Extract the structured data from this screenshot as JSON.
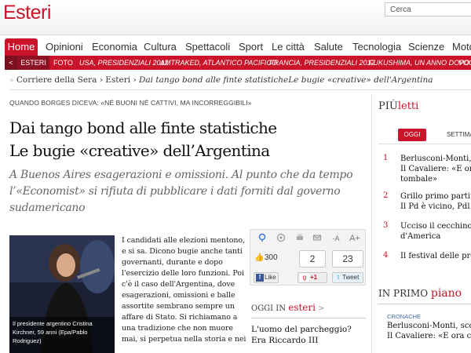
{
  "header": {
    "section_title": "Esteri",
    "search_placeholder": "Cerca"
  },
  "nav": {
    "items": [
      "Home",
      "Opinioni",
      "Economia",
      "Cultura",
      "Spettacoli",
      "Sport",
      "Le città",
      "Salute",
      "Tecnologia",
      "Scienze",
      "Moto"
    ]
  },
  "subnav": {
    "arrow": "<",
    "items": [
      "ESTERI",
      "FOTO",
      "USA, PRESIDENZIALI 2012",
      "AMTRAKED, ATLANTICO PACIFICO",
      "FRANCIA, PRESIDENZIALI 2012",
      "FUKUSHIMA, UN ANNO DOPO",
      "VOC"
    ]
  },
  "breadcrumb": {
    "items": [
      "Corriere della Sera",
      "Esteri",
      "Dai tango bond alle finte statisticheLe bugie «creative» dell'Argentina"
    ]
  },
  "article": {
    "kicker": "QUANDO BORGES DICEVA: «NÉ BUONI NÉ CATTIVI, MA INCORREGGIBILI»",
    "headline_line1": "Dai tango bond alle finte statistiche",
    "headline_line2": "Le bugie «creative» dell’Argentina",
    "subtitle": "A Buenos Aires esagerazioni e omissioni. Al punto che da tempo l’«Economist» si rifiuta di pubblicare i dati forniti dal governo sudamericano",
    "photo_caption": "Il presidente argentino Cristina Kirchner, 59 anni (Epa/Pablo Rodriguez)",
    "body_lines": [
      "I candidati alle elezioni mentono,",
      "e si sa. Dicono bugie anche tanti",
      "governanti, durante e dopo",
      "l'esercizio delle loro funzioni. Poi",
      "c'è il caso dell'Argentina, dove",
      "esagerazioni, omissioni e balle",
      "assortite sembrano sempre un",
      "affare di Stato. Si richiamano a",
      "una tradizione che non muore",
      "mai, si perpetua nella storia e nei"
    ]
  },
  "tools": {
    "icons": [
      "map-pin",
      "email",
      "print",
      "mail",
      "font-smaller",
      "font-bigger"
    ],
    "font_small": "-A",
    "font_big": "A+",
    "like_count": "300",
    "gplus_count": "2",
    "tweet_count": "23",
    "like_label": "Like",
    "gplus_label": "+1",
    "tweet_label": "Tweet"
  },
  "oggi_in": {
    "prefix": "OGGI IN",
    "section": "esteri",
    "chevron": ">",
    "item": "L'uomo del parcheggio? Era Riccardo III"
  },
  "piu_letti": {
    "prefix": "PIÙ",
    "suffix": "letti",
    "tab_active": "OGGI",
    "tab_other": "SETTIMA",
    "items": [
      {
        "rank": "1",
        "lines": [
          "Berlusconi-Monti, s",
          "Il Cavaliere: «E ora",
          "tombale»"
        ]
      },
      {
        "rank": "2",
        "lines": [
          "Grillo primo partito",
          "Il Pd è vicino, Pdl fe"
        ]
      },
      {
        "rank": "3",
        "lines": [
          "Ucciso il cecchino p",
          "d'America"
        ]
      },
      {
        "rank": "4",
        "lines": [
          "Il festival delle pro"
        ]
      }
    ]
  },
  "in_primo_piano": {
    "prefix": "IN PRIMO",
    "suffix": "piano",
    "category": "CRONACHE",
    "item_lines": [
      "Berlusconi-Monti, scon",
      "Il Cavaliere: «E ora con"
    ]
  },
  "colors": {
    "brand_red": "#c9142a",
    "subnav_dark": "#8e1223"
  }
}
